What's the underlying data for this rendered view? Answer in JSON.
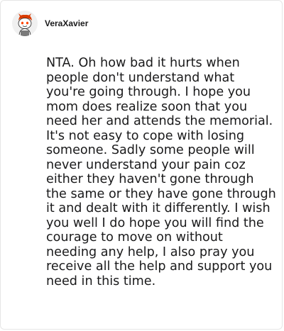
{
  "comment": {
    "author": "VeraXavier",
    "avatar_icon": "reddit-snoo-avatar-icon",
    "text": "NTA. Oh how bad it hurts when people don't understand what you're going through. I hope you mom does realize soon that you need her and attends the memorial. It's not easy to cope with losing someone. Sadly some people will never understand your pain coz either they haven't gone through the same or they have gone through it and dealt with it differently. I wish you well I do hope you will find the courage to move on without needing any help, I also pray you receive all the help and support you need in this time."
  },
  "colors": {
    "text": "#1a1a1b",
    "border": "#e6e6e6",
    "accent": "#ff4500"
  }
}
